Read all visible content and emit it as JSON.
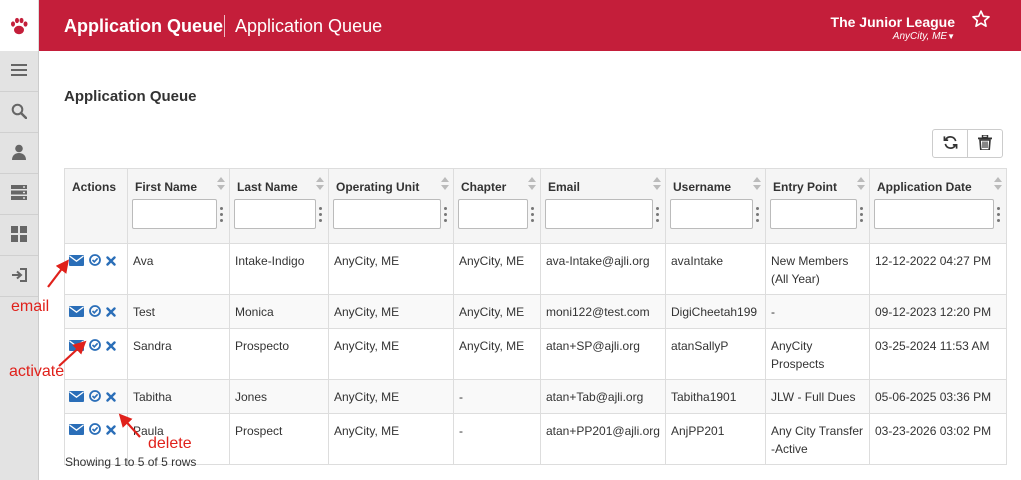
{
  "header": {
    "app_title": "Application Queue",
    "page_title": "Application Queue",
    "org_name": "The Junior League",
    "org_location": "AnyCity, ME",
    "colors": {
      "brand": "#c41e3a",
      "icon_blue": "#2a6eb8"
    }
  },
  "sidebar": {
    "items": [
      {
        "icon": "menu-icon"
      },
      {
        "icon": "search-icon"
      },
      {
        "icon": "user-icon"
      },
      {
        "icon": "server-icon"
      },
      {
        "icon": "grid-icon"
      },
      {
        "icon": "logout-icon"
      }
    ]
  },
  "content": {
    "title": "Application Queue"
  },
  "toolbar": {
    "refresh_icon": "refresh-icon",
    "delete_icon": "trash-icon"
  },
  "table": {
    "columns": [
      "Actions",
      "First Name",
      "Last Name",
      "Operating Unit",
      "Chapter",
      "Email",
      "Username",
      "Entry Point",
      "Application Date"
    ],
    "rows": [
      {
        "first": "Ava",
        "last": "Intake-Indigo",
        "unit": "AnyCity, ME",
        "chapter": "AnyCity, ME",
        "email": "ava-Intake@ajli.org",
        "username": "avaIntake",
        "entry": "New Members (All Year)",
        "date": "12-12-2022 04:27 PM"
      },
      {
        "first": "Test",
        "last": "Monica",
        "unit": "AnyCity, ME",
        "chapter": "AnyCity, ME",
        "email": "moni122@test.com",
        "username": "DigiCheetah199",
        "entry": "-",
        "date": "09-12-2023 12:20 PM"
      },
      {
        "first": "Sandra",
        "last": "Prospecto",
        "unit": "AnyCity, ME",
        "chapter": "AnyCity, ME",
        "email": "atan+SP@ajli.org",
        "username": "atanSallyP",
        "entry": "AnyCity Prospects",
        "date": "03-25-2024 11:53 AM"
      },
      {
        "first": "Tabitha",
        "last": "Jones",
        "unit": "AnyCity, ME",
        "chapter": "-",
        "email": "atan+Tab@ajli.org",
        "username": "Tabitha1901",
        "entry": "JLW - Full Dues",
        "date": "05-06-2025 03:36 PM"
      },
      {
        "first": "Paula",
        "last": "Prospect",
        "unit": "AnyCity, ME",
        "chapter": "-",
        "email": "atan+PP201@ajli.org",
        "username": "AnjPP201",
        "entry": "Any City Transfer -Active",
        "date": "03-23-2026 03:02 PM"
      }
    ]
  },
  "pagination": {
    "summary": "Showing 1 to 5 of 5 rows"
  },
  "annotations": {
    "email": "email",
    "activate": "activate",
    "delete": "delete",
    "color": "#e0211b"
  }
}
